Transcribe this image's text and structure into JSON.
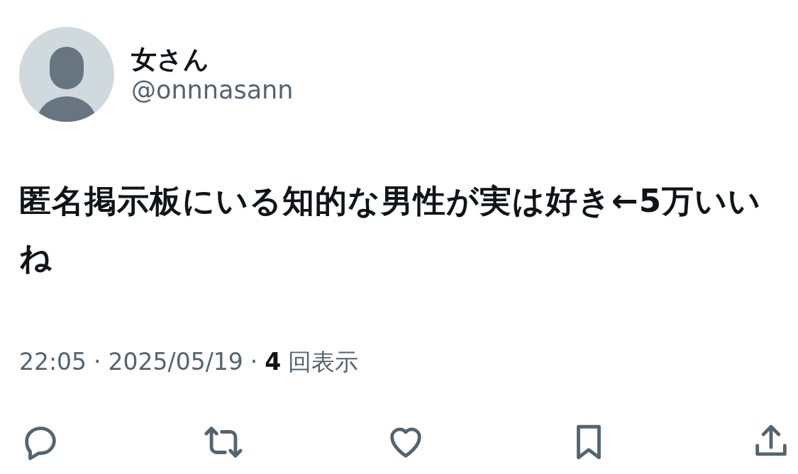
{
  "author": {
    "name": "女さん",
    "handle": "@onnnasann"
  },
  "text": "匿名掲示板にいる知的な男性が実は好き←5万いいね",
  "meta": {
    "time": "22:05",
    "separator": "·",
    "date": "2025/05/19",
    "separator_2": "·",
    "views_count": "4",
    "views_label": "回表示"
  },
  "actions": [
    {
      "kind": "reply"
    },
    {
      "kind": "repost"
    },
    {
      "kind": "like"
    },
    {
      "kind": "bookmark"
    },
    {
      "kind": "share"
    }
  ]
}
